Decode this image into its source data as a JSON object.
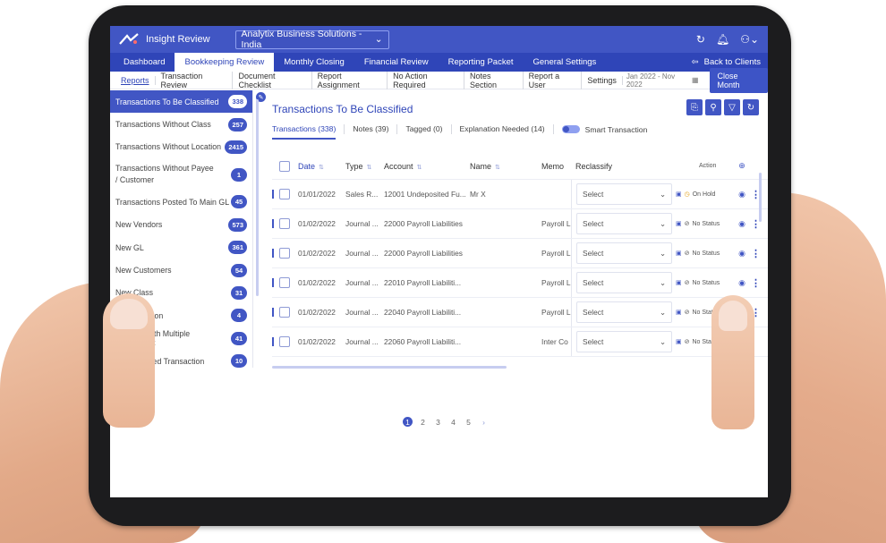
{
  "topbar": {
    "app_title": "Insight Review",
    "company": "Analytix Business Solutions - India",
    "icons": [
      "refresh-icon",
      "bell-icon",
      "user-icon"
    ]
  },
  "navbar": {
    "tabs": [
      "Dashboard",
      "Bookkeeping Review",
      "Monthly Closing",
      "Financial Review",
      "Reporting Packet",
      "General Settings"
    ],
    "active_tab": "Bookkeeping Review",
    "back_label": "Back to Clients"
  },
  "subnav": {
    "items": [
      "Reports",
      "Transaction Review",
      "Document Checklist",
      "Report Assignment",
      "No Action Required",
      "Notes Section",
      "Report a User",
      "Settings"
    ],
    "date_range": "Jan 2022 - Nov 2022",
    "close_month": "Close Month"
  },
  "sidebar": {
    "items": [
      {
        "label": "Transactions To Be Classified",
        "count": "338"
      },
      {
        "label": "Transactions Without Class",
        "count": "257"
      },
      {
        "label": "Transactions Without Location",
        "count": "2415"
      },
      {
        "label": "Transactions Without Payee / Customer",
        "count": "1"
      },
      {
        "label": "Transactions Posted To Main GL",
        "count": "45"
      },
      {
        "label": "New Vendors",
        "count": "573"
      },
      {
        "label": "New GL",
        "count": "361"
      },
      {
        "label": "New Customers",
        "count": "54"
      },
      {
        "label": "New Class",
        "count": "31"
      },
      {
        "label": "New Location",
        "count": "4"
      },
      {
        "label": "Vendors with Multiple GL/Amount",
        "count": "41"
      },
      {
        "label": "Unreconciled Transaction",
        "count": "10"
      }
    ]
  },
  "main": {
    "title": "Transactions To Be Classified",
    "tabs": [
      "Transactions (338)",
      "Notes (39)",
      "Tagged (0)",
      "Explanation Needed (14)"
    ],
    "smart_label": "Smart Transaction",
    "headers": {
      "date": "Date",
      "type": "Type",
      "account": "Account",
      "name": "Name",
      "memo": "Memo",
      "reclassify": "Reclassify",
      "action": "Action"
    },
    "rows": [
      {
        "date": "01/01/2022",
        "type": "Sales R...",
        "account": "12001 Undeposited Fu...",
        "name": "Mr X",
        "memo": "",
        "select": "Select",
        "status": "On Hold"
      },
      {
        "date": "01/02/2022",
        "type": "Journal ...",
        "account": "22000 Payroll Liabilities",
        "name": "",
        "memo": "Payroll L",
        "select": "Select",
        "status": "No Status"
      },
      {
        "date": "01/02/2022",
        "type": "Journal ...",
        "account": "22000 Payroll Liabilities",
        "name": "",
        "memo": "Payroll L",
        "select": "Select",
        "status": "No Status"
      },
      {
        "date": "01/02/2022",
        "type": "Journal ...",
        "account": "22010 Payroll Liabiliti...",
        "name": "",
        "memo": "Payroll L",
        "select": "Select",
        "status": "No Status"
      },
      {
        "date": "01/02/2022",
        "type": "Journal ...",
        "account": "22040 Payroll Liabiliti...",
        "name": "",
        "memo": "Payroll L",
        "select": "Select",
        "status": "No Status"
      },
      {
        "date": "01/02/2022",
        "type": "Journal ...",
        "account": "22060 Payroll Liabiliti...",
        "name": "",
        "memo": "Inter Co",
        "select": "Select",
        "status": "No Status"
      }
    ]
  },
  "pagination": {
    "pages": [
      "1",
      "2",
      "3",
      "4",
      "5"
    ],
    "active": "1",
    "next": "›"
  },
  "colors": {
    "primary": "#4156c4",
    "nav": "#2f45b8"
  }
}
